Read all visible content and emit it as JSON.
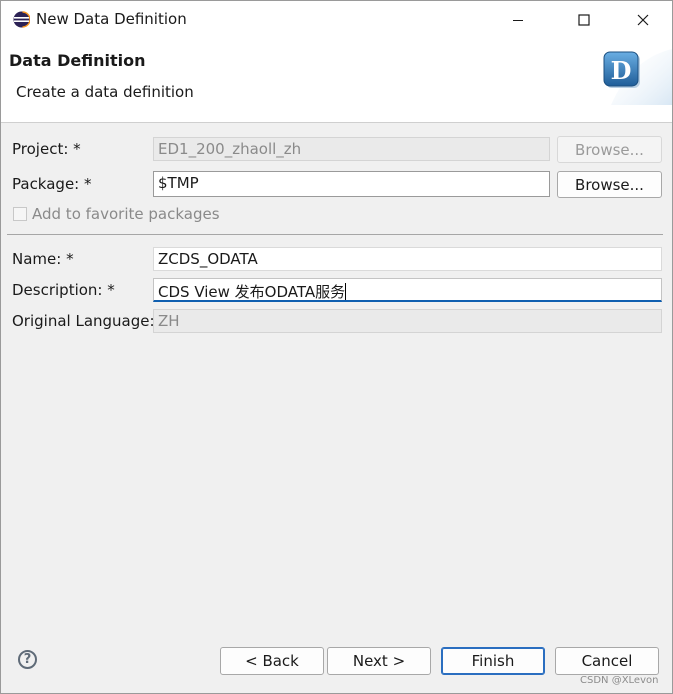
{
  "window": {
    "title": "New Data Definition",
    "icon": "eclipse-icon"
  },
  "banner": {
    "title": "Data Definition",
    "description": "Create a data definition",
    "logo_letter": "D"
  },
  "form": {
    "project": {
      "label": "Project: *",
      "value": "ED1_200_zhaoll_zh",
      "browse": "Browse..."
    },
    "package": {
      "label": "Package: *",
      "value": "$TMP",
      "browse": "Browse..."
    },
    "favorite": {
      "label": "Add to favorite packages"
    },
    "name": {
      "label": "Name: *",
      "value": "ZCDS_ODATA"
    },
    "description": {
      "label": "Description: *",
      "value": "CDS View 发布ODATA服务"
    },
    "language": {
      "label": "Original Language:",
      "value": "ZH"
    }
  },
  "footer": {
    "help": "?",
    "back": "< Back",
    "next": "Next >",
    "finish": "Finish",
    "cancel": "Cancel"
  },
  "watermark": "CSDN @XLevon",
  "colors": {
    "focus_underline": "#0f5fb0",
    "default_button_border": "#2a6ec0",
    "logo_blue": "#2b6ca8"
  }
}
